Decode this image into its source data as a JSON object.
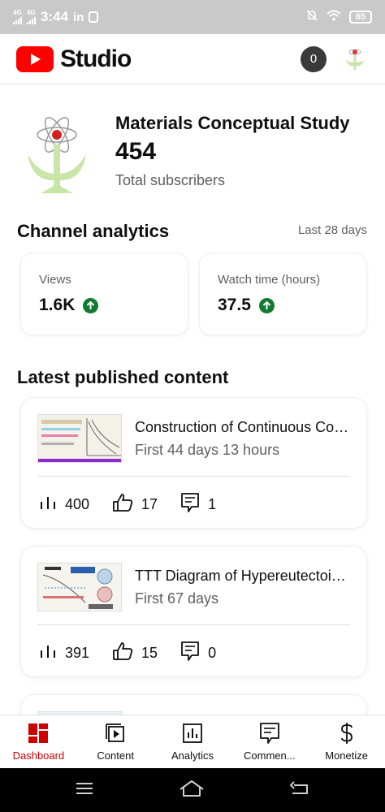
{
  "status_bar": {
    "net1": "4G",
    "net2": "4G",
    "time": "3:44",
    "extra": "in",
    "battery": "65"
  },
  "app_bar": {
    "brand": "Studio",
    "notification_count": "0"
  },
  "channel": {
    "name": "Materials Conceptual Study",
    "subscribers": "454",
    "subscribers_label": "Total subscribers"
  },
  "analytics": {
    "title": "Channel analytics",
    "period": "Last 28 days",
    "metrics": [
      {
        "label": "Views",
        "value": "1.6K",
        "trend": "up"
      },
      {
        "label": "Watch time (hours)",
        "value": "37.5",
        "trend": "up"
      }
    ]
  },
  "latest": {
    "title": "Latest published content",
    "videos": [
      {
        "title": "Construction of Continuous Cooling Transformation Diagram",
        "age": "First 44 days 13 hours",
        "views": "400",
        "likes": "17",
        "comments": "1"
      },
      {
        "title": "TTT Diagram of Hypereutectoid Steel",
        "age": "First 67 days",
        "views": "391",
        "likes": "15",
        "comments": "0"
      }
    ]
  },
  "bottom_nav": [
    {
      "label": "Dashboard",
      "icon": "dashboard-icon",
      "active": true
    },
    {
      "label": "Content",
      "icon": "content-icon",
      "active": false
    },
    {
      "label": "Analytics",
      "icon": "analytics-icon",
      "active": false
    },
    {
      "label": "Commen...",
      "icon": "comments-icon",
      "active": false
    },
    {
      "label": "Monetize",
      "icon": "dollar-icon",
      "active": false
    }
  ],
  "colors": {
    "brand_red": "#ff0000",
    "active_red": "#cc0000",
    "trend_green": "#127a2f"
  }
}
